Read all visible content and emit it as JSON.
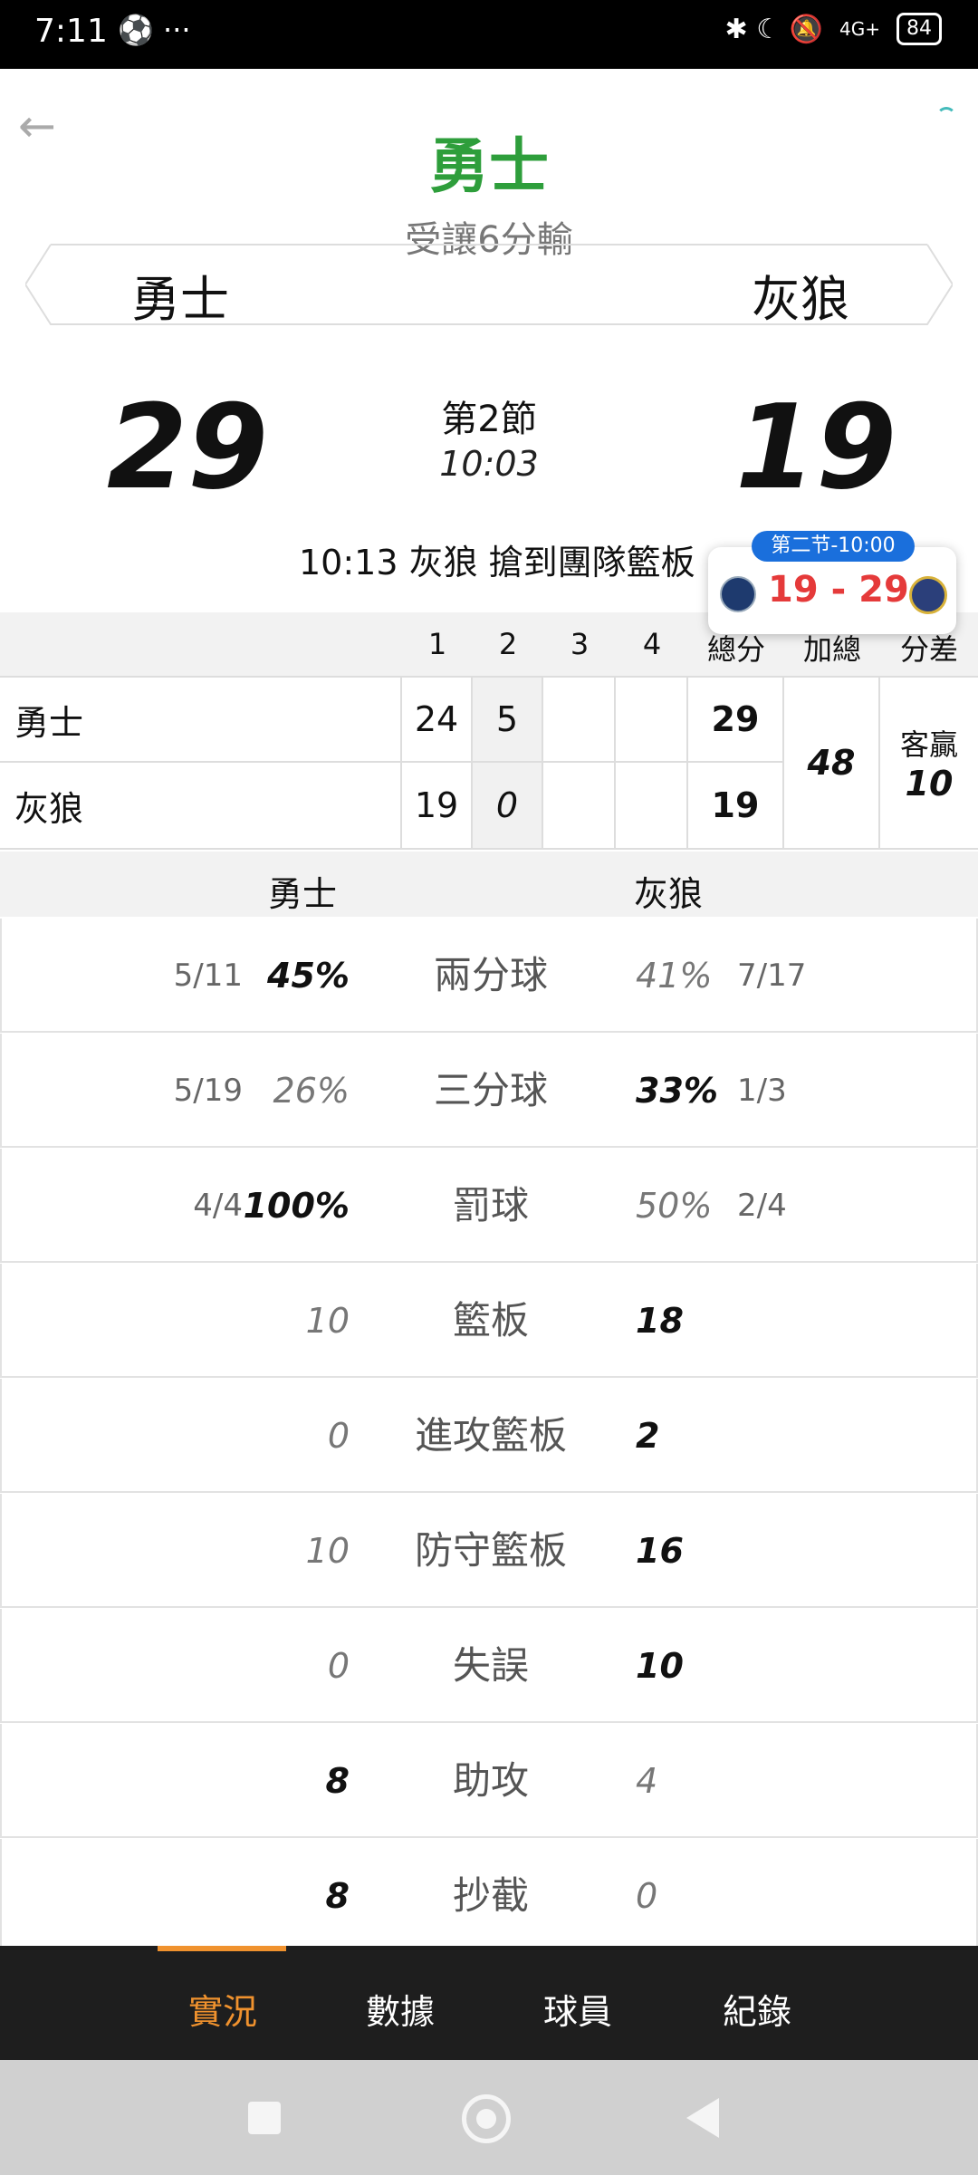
{
  "status_bar": {
    "time": "7:11",
    "left_icons": "⚽ ···",
    "right_icons": "✱ ☾ 🔕",
    "network": "4G+",
    "battery": "84"
  },
  "header": {
    "winner_team": "勇士",
    "spread_text": "受讓6分輸",
    "home_team": "勇士",
    "away_team": "灰狼"
  },
  "scoreboard": {
    "home_score": "29",
    "away_score": "19",
    "period": "第2節",
    "clock": "10:03",
    "last_event": "10:13 灰狼  搶到團隊籃板"
  },
  "mini_popup": {
    "badge": "第二节-10:00",
    "score": "19 - 29"
  },
  "quarter_table": {
    "headers": [
      "1",
      "2",
      "3",
      "4",
      "總分",
      "加總",
      "分差"
    ],
    "rows": [
      {
        "team": "勇士",
        "q1": "24",
        "q2": "5",
        "q3": "",
        "q4": "",
        "total": "29"
      },
      {
        "team": "灰狼",
        "q1": "19",
        "q2": "0",
        "q3": "",
        "q4": "",
        "total": "19"
      }
    ],
    "sum": "48",
    "diff_label": "客贏",
    "diff_value": "10"
  },
  "stats": {
    "home_team": "勇士",
    "away_team": "灰狼",
    "rows": [
      {
        "label": "兩分球",
        "home_frac": "5/11",
        "home_val": "45%",
        "away_val": "41%",
        "away_frac": "7/17",
        "lead": "home"
      },
      {
        "label": "三分球",
        "home_frac": "5/19",
        "home_val": "26%",
        "away_val": "33%",
        "away_frac": "1/3",
        "lead": "away"
      },
      {
        "label": "罰球",
        "home_frac": "4/4",
        "home_val": "100%",
        "away_val": "50%",
        "away_frac": "2/4",
        "lead": "home"
      },
      {
        "label": "籃板",
        "home_frac": "",
        "home_val": "10",
        "away_val": "18",
        "away_frac": "",
        "lead": "away"
      },
      {
        "label": "進攻籃板",
        "home_frac": "",
        "home_val": "0",
        "away_val": "2",
        "away_frac": "",
        "lead": "away"
      },
      {
        "label": "防守籃板",
        "home_frac": "",
        "home_val": "10",
        "away_val": "16",
        "away_frac": "",
        "lead": "away"
      },
      {
        "label": "失誤",
        "home_frac": "",
        "home_val": "0",
        "away_val": "10",
        "away_frac": "",
        "lead": "away"
      },
      {
        "label": "助攻",
        "home_frac": "",
        "home_val": "8",
        "away_val": "4",
        "away_frac": "",
        "lead": "home"
      },
      {
        "label": "抄截",
        "home_frac": "",
        "home_val": "8",
        "away_val": "0",
        "away_frac": "",
        "lead": "home"
      }
    ]
  },
  "bottom_nav": {
    "tabs": [
      "實況",
      "數據",
      "球員",
      "紀錄"
    ],
    "active": "實況"
  },
  "colors": {
    "winner_green": "#2e9e3b",
    "accent_orange": "#f0922e",
    "popup_blue": "#1a6fdc",
    "popup_score_red": "#e53a3a"
  }
}
